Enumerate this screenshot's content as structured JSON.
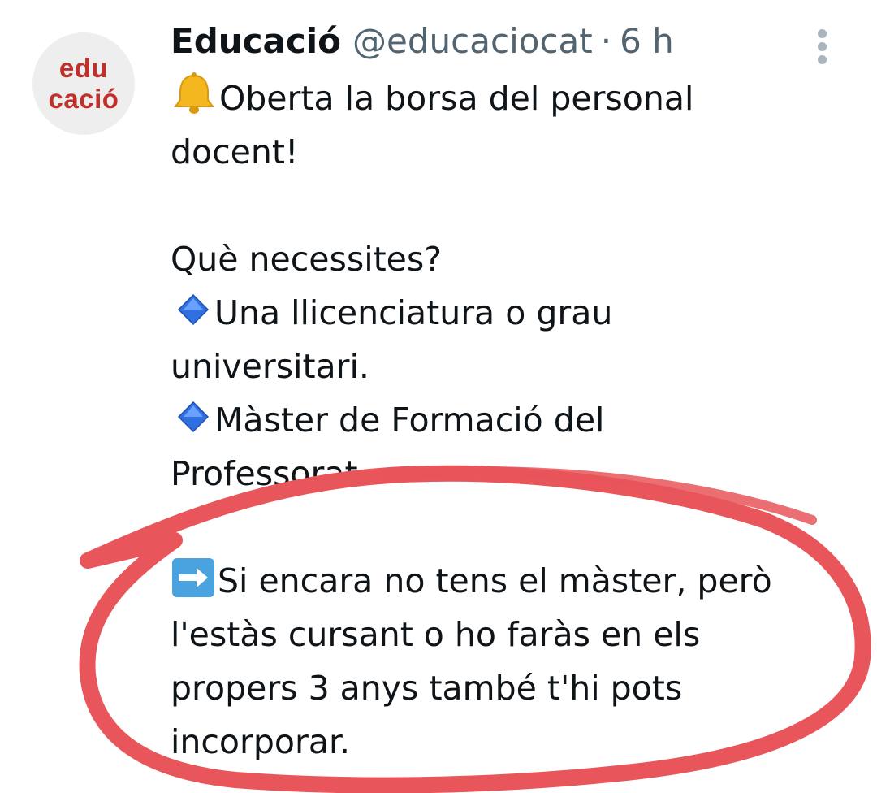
{
  "avatar": {
    "line1": "edu",
    "line2": "cació"
  },
  "tweet": {
    "display_name": "Educació",
    "handle": "@educaciocat",
    "separator": "·",
    "time": "6 h",
    "lines": {
      "l1": "Oberta la borsa del personal",
      "l2": "docent!",
      "l3": "Què necessites?",
      "l4": "Una llicenciatura o grau",
      "l5": "universitari.",
      "l6": "Màster de Formació del",
      "l7": "Professorat.",
      "l8": "Si encara no tens el màster, però",
      "l9": "l'estàs cursant o ho faràs en els",
      "l10": "propers 3 anys també t'hi pots",
      "l11": "incorporar."
    }
  },
  "icons": {
    "bell": "bell-emoji",
    "bullet": "blue-diamond-emoji",
    "arrow": "right-arrow-emoji",
    "more": "more-options-icon"
  },
  "colors": {
    "avatar_text": "#c0302a",
    "secondary_text": "#536471",
    "annotation_stroke": "#e8555a"
  }
}
